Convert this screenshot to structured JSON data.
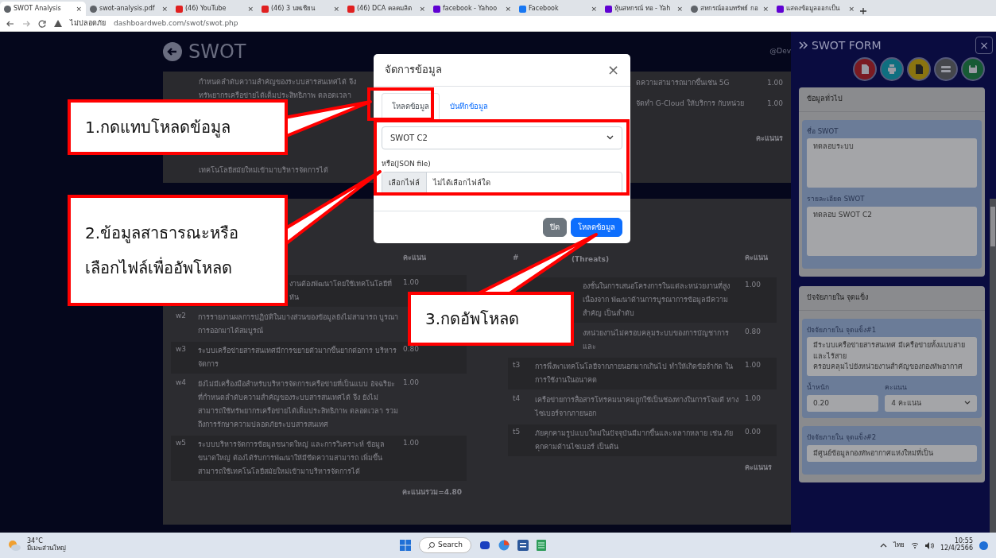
{
  "browser": {
    "tabs": [
      {
        "title": "SWOT Analysis",
        "kind": "site",
        "close": "×",
        "selected": true
      },
      {
        "title": "swot-analysis.pdf",
        "kind": "site",
        "close": "×",
        "selected": false
      },
      {
        "title": "(46) YouTube",
        "kind": "video",
        "close": "×",
        "selected": false
      },
      {
        "title": "(46) 3 นพเชียน",
        "kind": "video",
        "close": "×",
        "selected": false
      },
      {
        "title": "(46) DCA คลคมลิต",
        "kind": "video",
        "close": "×",
        "selected": false
      },
      {
        "title": "facebook - Yahoo",
        "kind": "yahoo",
        "close": "×",
        "selected": false
      },
      {
        "title": "Facebook",
        "kind": "facebook",
        "close": "×",
        "selected": false
      },
      {
        "title": "หุ้นสหกรณ์ ทอ - Yah",
        "kind": "yahoo",
        "close": "×",
        "selected": false
      },
      {
        "title": "สหกรณ์ออมทรัพย์ กอ",
        "kind": "site",
        "close": "×",
        "selected": false
      },
      {
        "title": "แสดงข้อมูลออกเป็น",
        "kind": "yahoo",
        "close": "×",
        "selected": false
      }
    ],
    "security": "ไม่ปลอดภัย",
    "url": "dashboardweb.com/swot/swot.php"
  },
  "page": {
    "title": "SWOT",
    "user": "@Dev",
    "upper_left": [
      {
        "text": "กำหนดลำดับความสำคัญของระบบสารสนเทศได้ จึง",
        "kind": "top"
      },
      {
        "text": "ทรัพยากรเครือข่ายได้เต็มประสิทธิภาพ ตลอดเวลา",
        "kind": "top"
      },
      {
        "text": "เทคโนโลยีสมัยใหม่เข้ามาบริหารจัดการได้",
        "kind": "bottom"
      }
    ],
    "upper_right": [
      {
        "text": "ดความสามารถมากขึ้นเช่น 5G",
        "score": "1.00"
      },
      {
        "text": "จัดทำ G-Cloud ให้บริการ กับหน่วย",
        "score": "1.00"
      }
    ],
    "upper_total": "คะแนนร",
    "weaknesses": {
      "score_header": "คะแนน",
      "rows": [
        {
          "id": "",
          "text": "งานต้องพัฒนาโดยใช้เทคโนโลยีที่ ทัน",
          "score": "1.00",
          "kind": "partial"
        },
        {
          "id": "w2",
          "text": "การรายงานผลการปฏิบัติในบางส่วนของข้อมูลยังไม่สามารถ บูรณาการออกมาได้สมบูรณ์",
          "score": "",
          "kind": "full"
        },
        {
          "id": "w3",
          "text": "ระบบเครือข่ายสารสนเทศมีการขยายตัวมากขึ้นยากต่อการ บริหารจัดการ",
          "score": "0.80",
          "kind": "full"
        },
        {
          "id": "w4",
          "text": "ยังไม่มีเครื่องมือสำหรับบริหารจัดการเครือข่ายที่เป็นแบบ อัจฉริยะ ที่กำหนดลำดับความสำคัญของระบบสารสนเทศได้ จึง ยังไม่สามารถใช้ทรัพยากรเครือข่ายได้เต็มประสิทธิภาพ ตลอดเวลา รวมถึงการรักษาความปลอดภัยระบบสารสนเทศ",
          "score": "1.00",
          "kind": "full"
        },
        {
          "id": "w5",
          "text": "ระบบบริหารจัดการข้อมูลขนาดใหญ่ และการวิเคราะห์ ข้อมูลขนาดใหญ่ ต้องได้รับการพัฒนาให้มีขีดความสามารถ เพิ่มขึ้น สามารถใช้เทคโนโลยีสมัยใหม่เข้ามาบริหารจัดการได้",
          "score": "1.00",
          "kind": "full"
        }
      ],
      "total": "คะแนนรวม=4.80"
    },
    "threats": {
      "id_header": "#",
      "title_header": "(Threats)",
      "score_header": "คะแนน",
      "rows": [
        {
          "id": "",
          "text": "องชั้นในการเสนอโครงการในแต่ละหน่วยงานที่สูง เนื่องจาก พัฒนาด้านการบูรณาการข้อมูลมีความสำคัญ เป็นลำดับ",
          "score": "1.00",
          "kind": "partial"
        },
        {
          "id": "",
          "text": "งหน่วยงานไม่ครอบคลุมระบบของการบัญชาการ และ",
          "score": "0.80",
          "kind": "partial"
        },
        {
          "id": "t3",
          "text": "การพึ่งพาเทคโนโลยีจากภายนอกมากเกินไป ทำให้เกิดข้อจำกัด ในการใช้งานในอนาคต",
          "score": "1.00",
          "kind": "full"
        },
        {
          "id": "t4",
          "text": "เครือข่ายการสื่อสารโทรคมนาคมถูกใช้เป็นช่องทางในการโจมตี ทางไซเบอร์จากภายนอก",
          "score": "1.00",
          "kind": "full"
        },
        {
          "id": "t5",
          "text": "ภัยคุกคามรูปแบบใหม่ในปัจจุบันมีมากขึ้นและหลากหลาย เช่น ภัยคุกคามด้านไซเบอร์ เป็นต้น",
          "score": "0.00",
          "kind": "full"
        }
      ],
      "total": "คะแนนร"
    }
  },
  "panel": {
    "title": "SWOT FORM",
    "close": "×",
    "actions": [
      {
        "kind": "pdf"
      },
      {
        "kind": "print"
      },
      {
        "kind": "excel"
      },
      {
        "kind": "list"
      },
      {
        "kind": "save"
      }
    ],
    "general": {
      "title": "ข้อมูลทั่วไป",
      "fields": [
        {
          "label": "ชื่อ SWOT",
          "value": "ทดลอบระบบ"
        },
        {
          "label": "รายละเอียด SWOT",
          "value": "ทดลอบ SWOT C2"
        }
      ]
    },
    "strengths": {
      "title": "ปัจจัยภายใน จุดแข็ง",
      "items": [
        {
          "label": "ปัจจัยภายใน จุดแข็ง#1",
          "value": "มีระบบเครือข่ายสารสนเทศ มีเครือข่ายทั้งแบบสายและไร้สาย\nครอบคลุมไปยังหน่วยงานสำคัญของกองทัพอากาศ",
          "weight_label": "น้ำหนัก",
          "weight": "0.20",
          "score_label": "คะแนน",
          "score": "4 คะแนน"
        },
        {
          "label": "ปัจจัยภายใน จุดแข็ง#2",
          "value": "มีศูนย์ข้อมูลกองทัพอากาศแห่งใหม่ที่เป็น"
        }
      ]
    }
  },
  "modal": {
    "title": "จัดการข้อมูล",
    "close": "×",
    "tabs": [
      {
        "label": "โหลดข้อมูล",
        "selected": true
      },
      {
        "label": "บันทึกข้อมูล",
        "selected": false
      }
    ],
    "select": "SWOT C2",
    "file_label": "หรือ(JSON file)",
    "file_button": "เลือกไฟล์",
    "file_status": "ไม่ได้เลือกไฟล์ใด",
    "buttons": [
      {
        "label": "ปิด",
        "kind": "secondary"
      },
      {
        "label": "โหลดข้อมูล",
        "kind": "primary"
      }
    ]
  },
  "callouts": [
    {
      "text": "1.กดแทบโหลดข้อมูล"
    },
    {
      "text": "2.ข้อมูลสาธารณะหรือ\nเลือกไฟล์เพื่ออัพโหลด"
    },
    {
      "text": "3.กดอัพโหลด"
    }
  ],
  "taskbar": {
    "temperature": "34°C",
    "weather": "มีเมฆส่วนใหญ่",
    "search": "Search",
    "language": "ไทย",
    "time": "10:55",
    "date": "12/4/2566"
  }
}
